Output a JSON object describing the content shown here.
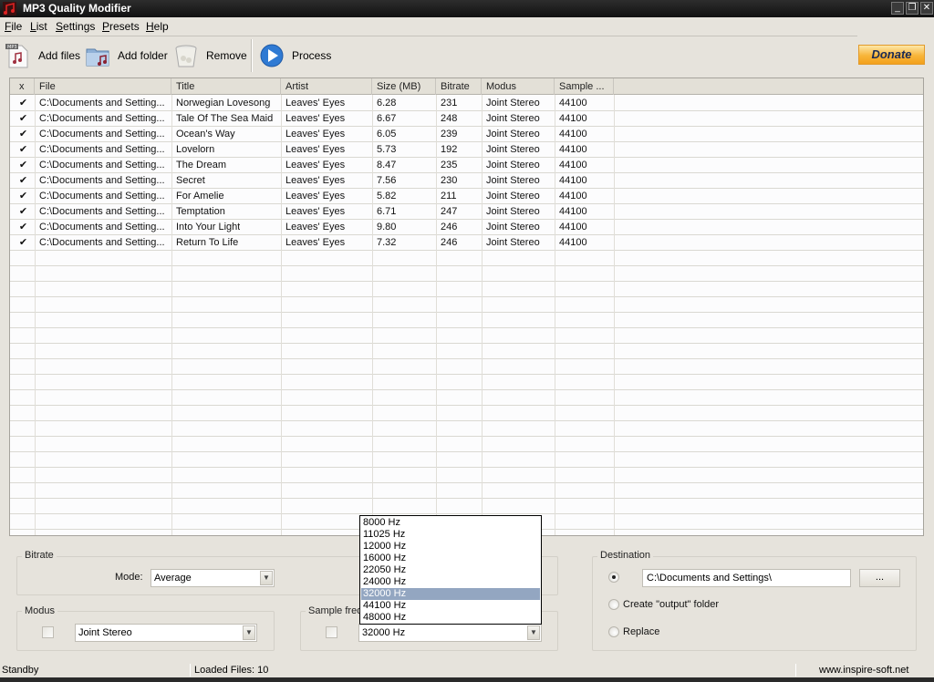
{
  "window": {
    "title": "MP3 Quality Modifier",
    "controls": [
      "minimize",
      "restore",
      "close"
    ]
  },
  "menu": {
    "items": [
      {
        "label": "File",
        "accel": "F"
      },
      {
        "label": "List",
        "accel": "L"
      },
      {
        "label": "Settings",
        "accel": "S"
      },
      {
        "label": "Presets",
        "accel": "P"
      },
      {
        "label": "Help",
        "accel": "H"
      }
    ]
  },
  "toolbar": {
    "add_files": "Add files",
    "add_folder": "Add folder",
    "remove": "Remove",
    "process": "Process",
    "donate": "Donate",
    "mp3_badge": "MP3"
  },
  "table": {
    "columns": [
      "x",
      "File",
      "Title",
      "Artist",
      "Size (MB)",
      "Bitrate",
      "Modus",
      "Sample ..."
    ],
    "rows": [
      {
        "checked": true,
        "file": "C:\\Documents and Setting...",
        "title": "Norwegian Lovesong",
        "artist": "Leaves' Eyes",
        "size": "6.28",
        "bitrate": "231",
        "modus": "Joint Stereo",
        "sample": "44100"
      },
      {
        "checked": true,
        "file": "C:\\Documents and Setting...",
        "title": "Tale Of The Sea Maid",
        "artist": "Leaves' Eyes",
        "size": "6.67",
        "bitrate": "248",
        "modus": "Joint Stereo",
        "sample": "44100"
      },
      {
        "checked": true,
        "file": "C:\\Documents and Setting...",
        "title": "Ocean's Way",
        "artist": "Leaves' Eyes",
        "size": "6.05",
        "bitrate": "239",
        "modus": "Joint Stereo",
        "sample": "44100"
      },
      {
        "checked": true,
        "file": "C:\\Documents and Setting...",
        "title": "Lovelorn",
        "artist": "Leaves' Eyes",
        "size": "5.73",
        "bitrate": "192",
        "modus": "Joint Stereo",
        "sample": "44100"
      },
      {
        "checked": true,
        "file": "C:\\Documents and Setting...",
        "title": "The Dream",
        "artist": "Leaves' Eyes",
        "size": "8.47",
        "bitrate": "235",
        "modus": "Joint Stereo",
        "sample": "44100"
      },
      {
        "checked": true,
        "file": "C:\\Documents and Setting...",
        "title": "Secret",
        "artist": "Leaves' Eyes",
        "size": "7.56",
        "bitrate": "230",
        "modus": "Joint Stereo",
        "sample": "44100"
      },
      {
        "checked": true,
        "file": "C:\\Documents and Setting...",
        "title": "For Amelie",
        "artist": "Leaves' Eyes",
        "size": "5.82",
        "bitrate": "211",
        "modus": "Joint Stereo",
        "sample": "44100"
      },
      {
        "checked": true,
        "file": "C:\\Documents and Setting...",
        "title": "Temptation",
        "artist": "Leaves' Eyes",
        "size": "6.71",
        "bitrate": "247",
        "modus": "Joint Stereo",
        "sample": "44100"
      },
      {
        "checked": true,
        "file": "C:\\Documents and Setting...",
        "title": "Into Your Light",
        "artist": "Leaves' Eyes",
        "size": "9.80",
        "bitrate": "246",
        "modus": "Joint Stereo",
        "sample": "44100"
      },
      {
        "checked": true,
        "file": "C:\\Documents and Setting...",
        "title": "Return To Life",
        "artist": "Leaves' Eyes",
        "size": "7.32",
        "bitrate": "246",
        "modus": "Joint Stereo",
        "sample": "44100"
      }
    ]
  },
  "bitrate": {
    "group_label": "Bitrate",
    "mode_label": "Mode:",
    "mode_value": "Average"
  },
  "modus": {
    "group_label": "Modus",
    "checked": false,
    "value": "Joint Stereo"
  },
  "sample_freq": {
    "group_label": "Sample frequency",
    "checked": false,
    "value": "32000 Hz",
    "options": [
      "8000 Hz",
      "11025 Hz",
      "12000 Hz",
      "16000 Hz",
      "22050 Hz",
      "24000 Hz",
      "32000 Hz",
      "44100 Hz",
      "48000 Hz"
    ],
    "selected_index": 6
  },
  "destination": {
    "group_label": "Destination",
    "path": "C:\\Documents and Settings\\",
    "browse_label": "...",
    "option_create_output": "Create \"output\" folder",
    "option_replace": "Replace",
    "selected": "path"
  },
  "status": {
    "state": "Standby",
    "loaded": "Loaded Files: 10",
    "website": "www.inspire-soft.net"
  },
  "colors": {
    "selection": "#93a6c1",
    "donate": "#f8b53a",
    "titlebar": "#1a1a1a"
  }
}
